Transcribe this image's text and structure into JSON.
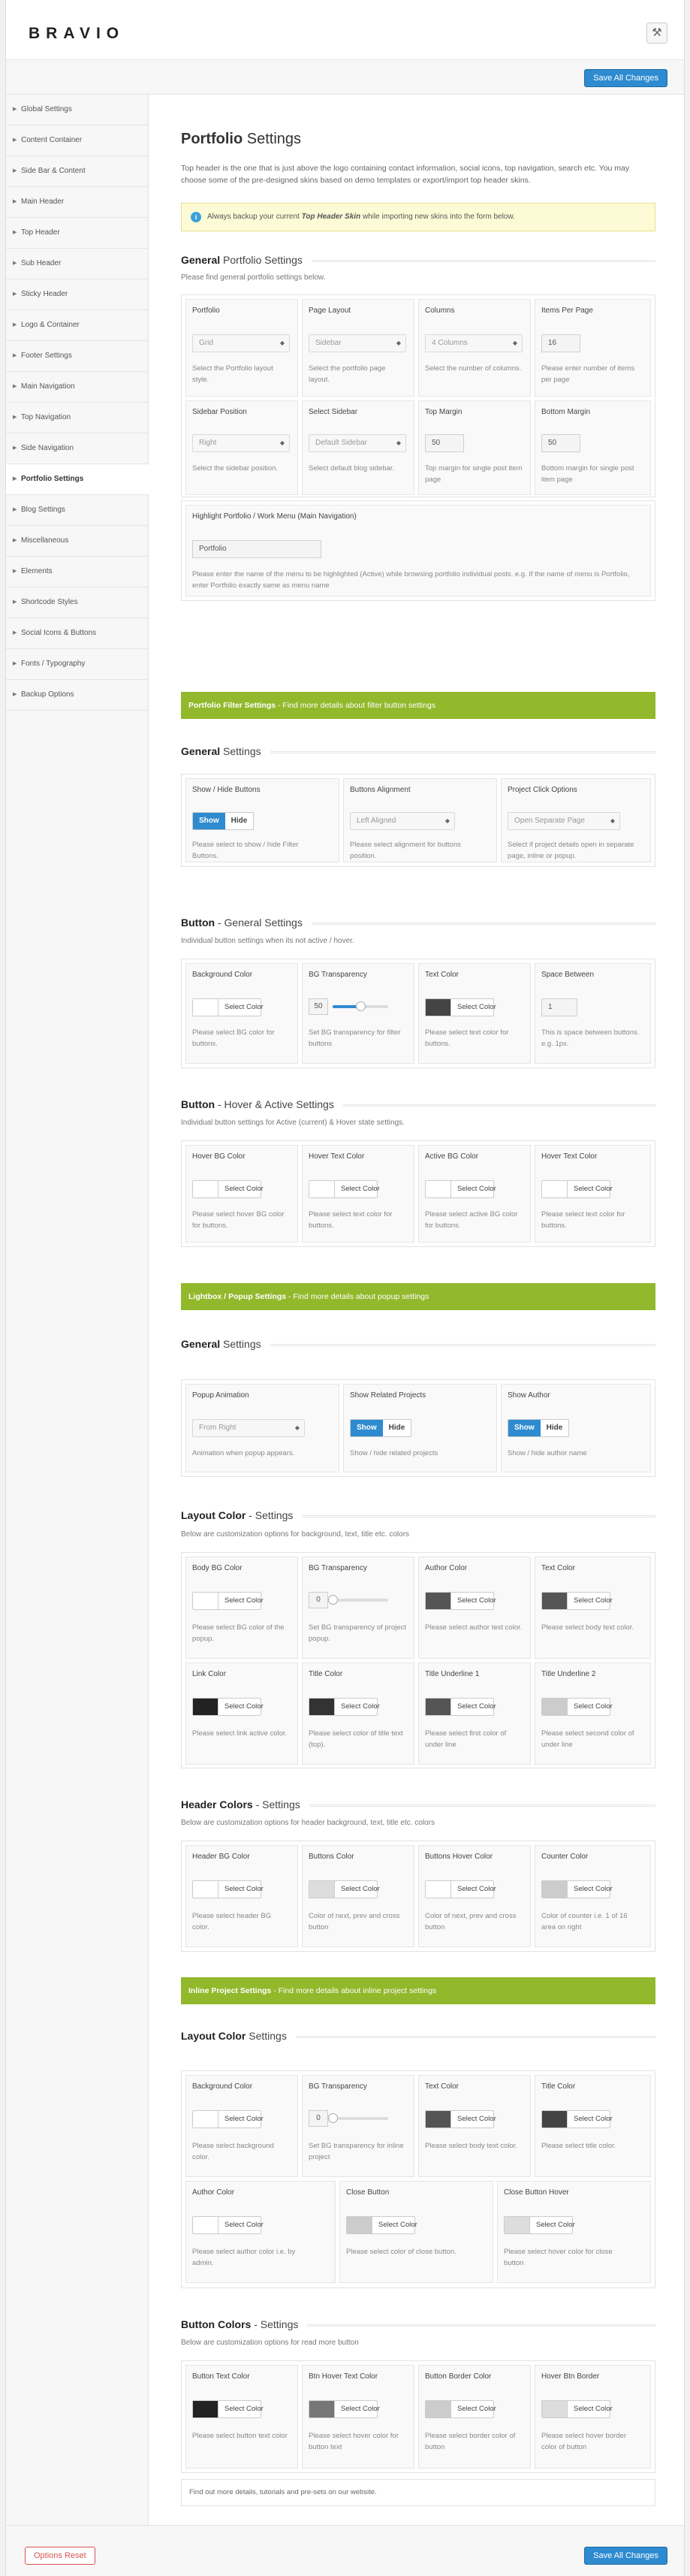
{
  "app": {
    "logo": "BRAVIO",
    "header_icon": "tools-icon"
  },
  "toolbar": {
    "save_label": "Save All Changes",
    "reset_label": "Options Reset"
  },
  "sidebar": {
    "items": [
      {
        "label": "Global Settings"
      },
      {
        "label": "Content Container"
      },
      {
        "label": "Side Bar & Content"
      },
      {
        "label": "Main Header"
      },
      {
        "label": "Top Header"
      },
      {
        "label": "Sub Header"
      },
      {
        "label": "Sticky Header"
      },
      {
        "label": "Logo & Container"
      },
      {
        "label": "Footer Settings"
      },
      {
        "label": "Main Navigation"
      },
      {
        "label": "Top Navigation"
      },
      {
        "label": "Side Navigation"
      },
      {
        "label": "Portfolio Settings",
        "active": true
      },
      {
        "label": "Blog Settings"
      },
      {
        "label": "Miscellaneous"
      },
      {
        "label": "Elements"
      },
      {
        "label": "Shortcode Styles"
      },
      {
        "label": "Social Icons & Buttons"
      },
      {
        "label": "Fonts / Typography"
      },
      {
        "label": "Backup Options"
      }
    ]
  },
  "page": {
    "title_bold": "Portfolio",
    "title_rest": " Settings",
    "intro": "Top header is the one that is just above the logo containing contact information, social icons, top navigation, search etc. You may choose some of the pre-designed skins based on demo templates or export/import top header skins.",
    "notice_pre": "Always backup your current ",
    "notice_em": "Top Header Skin",
    "notice_post": " while importing new skins into the form below."
  },
  "general": {
    "title_bold": "General",
    "title_rest": " Portfolio Settings",
    "sub": "Please find general portfolio settings below.",
    "portfolio": {
      "label": "Portfolio",
      "value": "Grid",
      "help": "Select the Portfolio layout style."
    },
    "page_layout": {
      "label": "Page Layout",
      "value": "Sidebar",
      "help": "Select the portfolio page layout."
    },
    "columns": {
      "label": "Columns",
      "value": "4 Columns",
      "help": "Select the number of columns."
    },
    "items_per_page": {
      "label": "Items Per Page",
      "value": "16",
      "help": "Please enter number of items per page"
    },
    "sidebar_position": {
      "label": "Sidebar Position",
      "value": "Right",
      "help": "Select the sidebar position."
    },
    "select_sidebar": {
      "label": "Select Sidebar",
      "value": "Default Sidebar",
      "help": "Select default blog sidebar."
    },
    "top_margin": {
      "label": "Top Margin",
      "value": "50",
      "help": "Top margin for single post item page"
    },
    "bottom_margin": {
      "label": "Bottom Margin",
      "value": "50",
      "help": "Bottom margin for single post item page"
    },
    "highlight": {
      "label": "Highlight Portfolio / Work Menu (Main Navigation)",
      "value": "Portfolio",
      "help": "Please enter the name of the menu to be highlighted (Active) while browsing portfolio individual posts. e.g. If the name of menu is Portfolio, enter Portfolio exactly same as menu name"
    }
  },
  "filter_bar": {
    "bold": "Portfolio Filter Settings",
    "rest": " - Find more details about filter button settings"
  },
  "filter_general": {
    "title_bold": "General",
    "title_rest": " Settings",
    "show_hide": {
      "label": "Show / Hide Buttons",
      "on": "Show",
      "off": "Hide",
      "help": "Please select to show / hide Filter Buttons."
    },
    "alignment": {
      "label": "Buttons Alignment",
      "value": "Left Aligned",
      "help": "Please select alignment for buttons position."
    },
    "click_options": {
      "label": "Project Click Options",
      "value": "Open Separate Page",
      "help": "Select if project details open in separate page, inline or popup."
    }
  },
  "button_general": {
    "title_bold": "Button",
    "title_rest": " - General Settings",
    "sub": "Individual button settings when its not active / hover.",
    "bg_color": {
      "label": "Background Color",
      "btn": "Select Color",
      "swatch": "#ffffff",
      "help": "Please select BG color for buttons."
    },
    "bg_trans": {
      "label": "BG Transparency",
      "value": "50",
      "help": "Set BG transparency for filter buttons"
    },
    "text_color": {
      "label": "Text Color",
      "btn": "Select Color",
      "swatch": "#444444",
      "help": "Please select text color for buttons."
    },
    "space": {
      "label": "Space Between",
      "value": "1",
      "help": "This is space between buttons. e.g. 1px."
    }
  },
  "button_hover": {
    "title_bold": "Button",
    "title_rest": " - Hover & Active Settings",
    "sub": "Individual button settings for Active (current) & Hover state settings.",
    "hover_bg": {
      "label": "Hover BG Color",
      "btn": "Select Color",
      "swatch": "#ffffff",
      "help": "Please select hover BG color for buttons."
    },
    "hover_text": {
      "label": "Hover Text Color",
      "btn": "Select Color",
      "swatch": "#ffffff",
      "help": "Please select text color for buttons."
    },
    "active_bg": {
      "label": "Active BG Color",
      "btn": "Select Color",
      "swatch": "#ffffff",
      "help": "Please select active BG color for buttons."
    },
    "hover_text2": {
      "label": "Hover Text Color",
      "btn": "Select Color",
      "swatch": "#ffffff",
      "help": "Please select text color for buttons."
    }
  },
  "lightbox_bar": {
    "bold": "Lightbox / Popup Settings",
    "rest": " - Find more details about popup settings"
  },
  "lightbox_general": {
    "title_bold": "General",
    "title_rest": " Settings",
    "animation": {
      "label": "Popup Animation",
      "value": "From Right",
      "help": "Animation when popup appears."
    },
    "related": {
      "label": "Show Related Projects",
      "on": "Show",
      "off": "Hide",
      "help": "Show / hide related projects"
    },
    "author": {
      "label": "Show Author",
      "on": "Show",
      "off": "Hide",
      "help": "Show / hide author name"
    }
  },
  "layout_color": {
    "title_bold": "Layout Color",
    "title_rest": " - Settings",
    "sub": "Below are customization options for background, text, title etc. colors",
    "body_bg": {
      "label": "Body BG Color",
      "btn": "Select Color",
      "swatch": "#ffffff",
      "help": "Please select BG color of the popup."
    },
    "bg_trans": {
      "label": "BG Transparency",
      "value": "0",
      "help": "Set BG transparency of project popup."
    },
    "author_color": {
      "label": "Author Color",
      "btn": "Select Color",
      "swatch": "#555555",
      "help": "Please select author text color."
    },
    "text_color": {
      "label": "Text Color",
      "btn": "Select Color",
      "swatch": "#555555",
      "help": "Please select body text color."
    },
    "link_color": {
      "label": "Link Color",
      "btn": "Select Color",
      "swatch": "#222222",
      "help": "Please select link active color."
    },
    "title_color": {
      "label": "Title Color",
      "btn": "Select Color",
      "swatch": "#333333",
      "help": "Please select color of title text (top)."
    },
    "underline1": {
      "label": "Title Underline 1",
      "btn": "Select Color",
      "swatch": "#555555",
      "help": "Please select first color of under line"
    },
    "underline2": {
      "label": "Title Underline 2",
      "btn": "Select Color",
      "swatch": "#cccccc",
      "help": "Please select second color of under line"
    }
  },
  "header_colors": {
    "title_bold": "Header Colors",
    "title_rest": " - Settings",
    "sub": "Below are customization options for header background, text, title etc. colors",
    "header_bg": {
      "label": "Header BG Color",
      "btn": "Select Color",
      "swatch": "#ffffff",
      "help": "Please select header BG color."
    },
    "buttons_color": {
      "label": "Buttons Color",
      "btn": "Select Color",
      "swatch": "#dddddd",
      "help": "Color of next, prev and cross button"
    },
    "buttons_hover": {
      "label": "Buttons Hover Color",
      "btn": "Select Color",
      "swatch": "#ffffff",
      "help": "Color of next, prev and cross button"
    },
    "counter": {
      "label": "Counter Color",
      "btn": "Select Color",
      "swatch": "#cccccc",
      "help": "Color of counter i.e. 1 of 16 area on right"
    }
  },
  "inline_bar": {
    "bold": "Inline Project Settings",
    "rest": " - Find more details about inline project settings"
  },
  "inline_layout": {
    "title_bold": "Layout Color",
    "title_rest": " Settings",
    "bg_color": {
      "label": "Background Color",
      "btn": "Select Color",
      "swatch": "#ffffff",
      "help": "Please select background color."
    },
    "bg_trans": {
      "label": "BG Transparency",
      "value": "0",
      "help": "Set BG transparency for inline project"
    },
    "text_color": {
      "label": "Text Color",
      "btn": "Select Color",
      "swatch": "#555555",
      "help": "Please select body text color."
    },
    "title_color": {
      "label": "Title Color",
      "btn": "Select Color",
      "swatch": "#444444",
      "help": "Please select title color."
    },
    "author_color": {
      "label": "Author Color",
      "btn": "Select Color",
      "swatch": "#ffffff",
      "help": "Please select author color i.e. by admin."
    },
    "close_btn": {
      "label": "Close Button",
      "btn": "Select Color",
      "swatch": "#cccccc",
      "help": "Please select color of close button."
    },
    "close_hover": {
      "label": "Close Button Hover",
      "btn": "Select Color",
      "swatch": "#dddddd",
      "help": "Please select hover color for close button"
    }
  },
  "button_colors": {
    "title_bold": "Button Colors",
    "title_rest": " - Settings",
    "sub": "Below are customization options for read more button",
    "text_color": {
      "label": "Button Text Color",
      "btn": "Select Color",
      "swatch": "#222222",
      "help": "Please select button text color"
    },
    "hover_text": {
      "label": "Btn Hover Text Color",
      "btn": "Select Color",
      "swatch": "#777777",
      "help": "Please select hover color for button text"
    },
    "border_color": {
      "label": "Button Border Color",
      "btn": "Select Color",
      "swatch": "#cccccc",
      "help": "Please select border color of button"
    },
    "hover_border": {
      "label": "Hover Btn Border",
      "btn": "Select Color",
      "swatch": "#dddddd",
      "help": "Please select hover border color of button"
    }
  },
  "footer_note": "Find out more details, tutorials and pre-sets on our website."
}
